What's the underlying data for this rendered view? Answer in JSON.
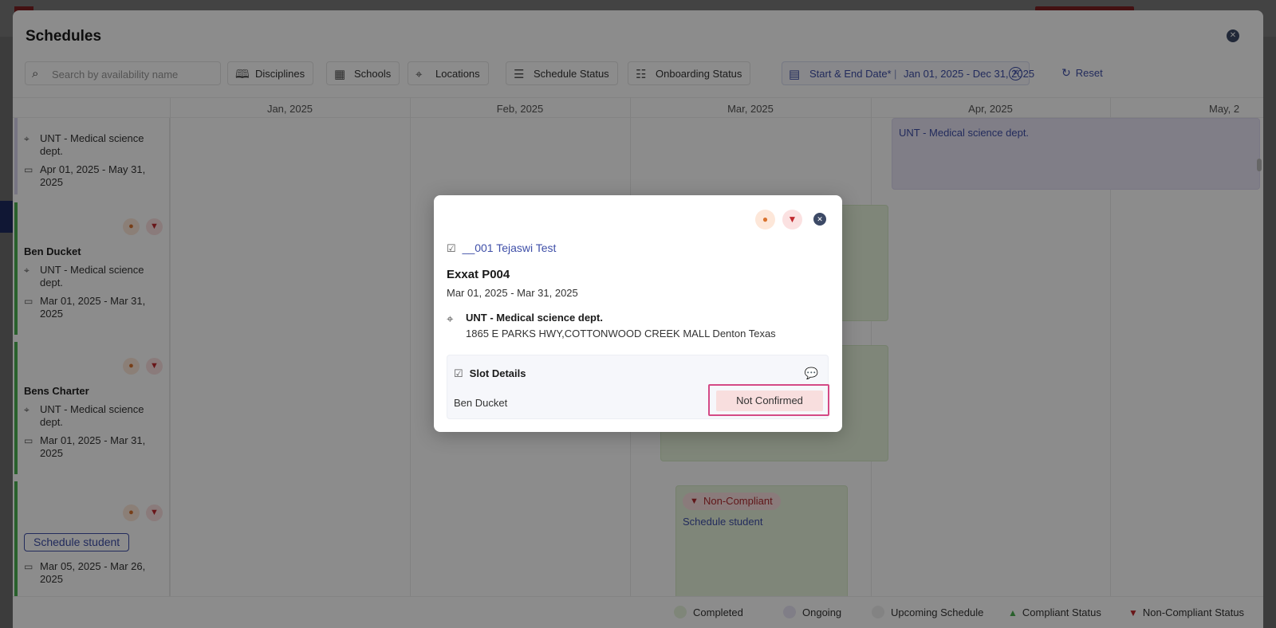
{
  "sheet": {
    "title": "Schedules"
  },
  "filters": {
    "search_placeholder": "Search by availability name",
    "disciplines": "Disciplines",
    "schools": "Schools",
    "locations": "Locations",
    "schedule_status": "Schedule Status",
    "onboarding_status": "Onboarding Status",
    "date_label": "Start & End Date*",
    "date_value": "Jan 01, 2025 - Dec 31, 2025",
    "reset": "Reset"
  },
  "months": [
    "Jan, 2025",
    "Feb, 2025",
    "Mar, 2025",
    "Apr, 2025",
    "May, 2"
  ],
  "rows": [
    {
      "location": "UNT - Medical science dept.",
      "dates": "Apr 01, 2025 - May 31, 2025"
    },
    {
      "name": "Ben Ducket",
      "location": "UNT - Medical science dept.",
      "dates": "Mar 01, 2025 - Mar 31, 2025"
    },
    {
      "name": "Bens  Charter",
      "location": "UNT - Medical science dept.",
      "dates": "Mar 01, 2025 - Mar 31, 2025"
    },
    {
      "action": "Schedule student",
      "dates": "Mar 05, 2025 - Mar 26, 2025"
    }
  ],
  "timeline": {
    "apr_block_text": "UNT - Medical science dept.",
    "badge": "Non-Compliant",
    "schedule_link": "Schedule student"
  },
  "legend": {
    "completed": "Completed",
    "ongoing": "Ongoing",
    "upcoming": "Upcoming Schedule",
    "compliant": "Compliant Status",
    "noncompliant": "Non-Compliant Status"
  },
  "modal": {
    "link": "__001 Tejaswi Test",
    "title": "Exxat P004",
    "dates": "Mar 01, 2025 - Mar 31, 2025",
    "location_name": "UNT - Medical science dept.",
    "address": "1865 E PARKS HWY,COTTONWOOD CREEK MALL Denton Texas",
    "slot_header": "Slot Details",
    "slot_student": "Ben Ducket",
    "slot_status": "Not Confirmed"
  },
  "colors": {
    "accent": "#3f4fa8",
    "completed": "#e8f4dd",
    "ongoing": "#e9e6f6",
    "upcoming": "#eeeeee",
    "compliant": "#4caf50",
    "noncompliant": "#c0282e",
    "highlight": "#d44a86"
  },
  "icons": {
    "search": "search-icon",
    "book": "book-icon",
    "building": "building-icon",
    "pin": "location-pin-icon",
    "list": "list-icon",
    "checklist": "checklist-icon",
    "calendar": "calendar-icon",
    "user": "user-icon",
    "thumbs_down": "thumbs-down-icon",
    "thumbs_up": "thumbs-up-icon",
    "close": "close-icon",
    "chat": "chat-icon",
    "reset": "refresh-icon"
  }
}
